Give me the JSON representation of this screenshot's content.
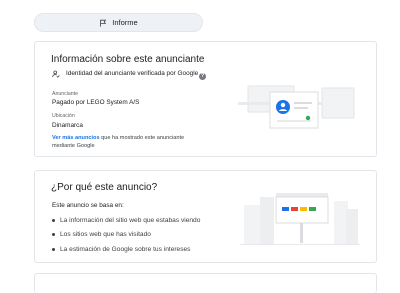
{
  "report_button": {
    "label": "Informe",
    "icon": "flag-icon"
  },
  "advertiser_card": {
    "title": "Información sobre este anunciante",
    "verified_text": "Identidad del anunciante verificada por Google",
    "advertiser_label": "Anunciante",
    "advertiser_value": "Pagado por LEGO System A/S",
    "location_label": "Ubicación",
    "location_value": "Dinamarca",
    "more_link": "Ver más anuncios",
    "more_text": " que ha mostrado este anunciante mediante Google"
  },
  "why_card": {
    "title": "¿Por qué este anuncio?",
    "intro": "Este anuncio se basa en:",
    "reasons": [
      "La información del sitio web que estabas viendo",
      "Los sitios web que has visitado",
      "La estimación de Google sobre tus intereses"
    ]
  },
  "colors": {
    "accent": "#1a73e8",
    "button_bg": "#eef1f5",
    "border": "#e2e5e9"
  }
}
